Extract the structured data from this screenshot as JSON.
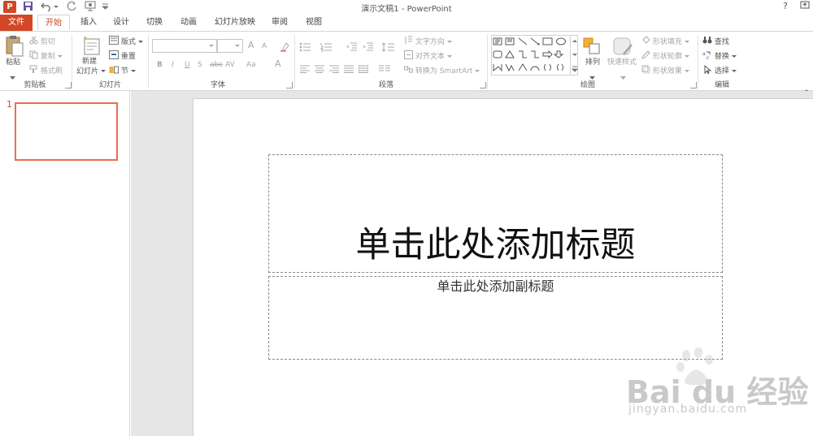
{
  "window": {
    "title": "演示文稿1 - PowerPoint",
    "app_icon": "P",
    "help": "?"
  },
  "tabs": [
    {
      "label": "文件"
    },
    {
      "label": "开始"
    },
    {
      "label": "插入"
    },
    {
      "label": "设计"
    },
    {
      "label": "切换"
    },
    {
      "label": "动画"
    },
    {
      "label": "幻灯片放映"
    },
    {
      "label": "审阅"
    },
    {
      "label": "视图"
    }
  ],
  "ribbon": {
    "clipboard": {
      "label": "剪贴板",
      "paste": "粘贴",
      "cut": "剪切",
      "copy": "复制",
      "format_painter": "格式刷"
    },
    "slides": {
      "label": "幻灯片",
      "new_slide_line1": "新建",
      "new_slide_line2": "幻灯片",
      "layout": "版式",
      "reset": "重置",
      "section": "节"
    },
    "font": {
      "label": "字体",
      "bold": "B",
      "italic": "I",
      "underline": "U",
      "strike": "S",
      "abc": "abc",
      "spacing": "AV",
      "case": "Aa",
      "color": "A",
      "grow": "A",
      "shrink": "A"
    },
    "paragraph": {
      "label": "段落",
      "text_direction": "文字方向",
      "align_text": "对齐文本",
      "smartart": "转换为 SmartArt"
    },
    "drawing": {
      "label": "绘图",
      "arrange": "排列",
      "quick_styles": "快速样式",
      "shape_fill": "形状填充",
      "shape_outline": "形状轮廓",
      "shape_effects": "形状效果"
    },
    "editing": {
      "label": "编辑",
      "find": "查找",
      "replace": "替换",
      "select": "选择"
    }
  },
  "thumbnails": [
    {
      "number": "1"
    }
  ],
  "slide": {
    "title_placeholder": "单击此处添加标题",
    "subtitle_placeholder": "单击此处添加副标题"
  },
  "watermark": {
    "logo": "Bai du 经验",
    "url": "jingyan.baidu.com"
  },
  "colors": {
    "accent": "#d24726",
    "thumb_border": "#e86d54",
    "workspace": "#e6e6e6"
  }
}
